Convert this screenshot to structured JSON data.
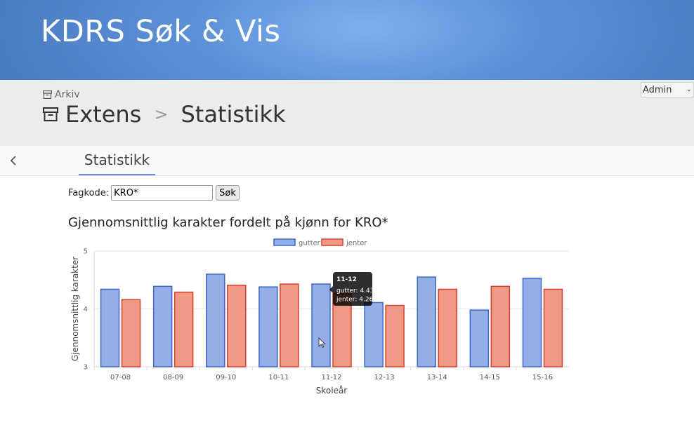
{
  "app": {
    "title": "KDRS Søk & Vis"
  },
  "breadcrumb": {
    "small": "Arkiv",
    "parent": "Extens",
    "separator": ">",
    "current": "Statistikk"
  },
  "user_menu": {
    "selected": "Admin"
  },
  "tabs": [
    {
      "label": "Statistikk",
      "active": true
    }
  ],
  "search": {
    "label": "Fagkode:",
    "value": "KRO*",
    "button": "Søk"
  },
  "chart_heading": "Gjennomsnittlig karakter fordelt på kjønn for KRO*",
  "colors": {
    "gutter_fill": "#94aee6",
    "gutter_stroke": "#3f67c8",
    "jenter_fill": "#ee9a86",
    "jenter_stroke": "#d6402a",
    "accent": "#6a8fd8"
  },
  "tooltip": {
    "title": "11-12",
    "lines": [
      "gutter: 4.43",
      "jenter: 4.26"
    ]
  },
  "chart_data": {
    "type": "bar",
    "categories": [
      "07-08",
      "08-09",
      "09-10",
      "10-11",
      "11-12",
      "12-13",
      "13-14",
      "14-15",
      "15-16"
    ],
    "series": [
      {
        "name": "gutter",
        "values": [
          4.34,
          4.39,
          4.6,
          4.38,
          4.43,
          4.11,
          4.55,
          3.98,
          4.53
        ]
      },
      {
        "name": "jenter",
        "values": [
          4.16,
          4.29,
          4.41,
          4.43,
          4.26,
          4.06,
          4.34,
          4.39,
          4.34
        ]
      }
    ],
    "xlabel": "Skoleår",
    "ylabel": "Gjennomsnittlig karakter",
    "ylim": [
      3,
      5
    ],
    "yticks": [
      "3",
      "4",
      "5"
    ],
    "grid": true,
    "legend": "top-center"
  }
}
